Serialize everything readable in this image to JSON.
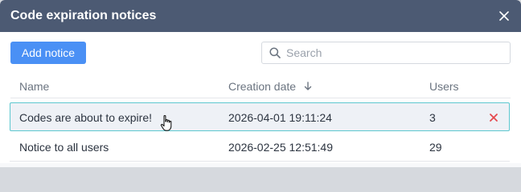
{
  "dialog": {
    "title": "Code expiration notices",
    "close_icon": "close-icon"
  },
  "toolbar": {
    "add_label": "Add notice",
    "search_placeholder": "Search",
    "search_value": "",
    "search_icon": "search-icon"
  },
  "table": {
    "columns": {
      "name": "Name",
      "creation_date": "Creation date",
      "users": "Users",
      "sort_icon": "arrow-down-icon"
    },
    "rows": [
      {
        "name": "Codes are about to expire!",
        "creation_date": "2026-04-01 19:11:24",
        "users": "3",
        "selected": true
      },
      {
        "name": "Notice to all users",
        "creation_date": "2026-02-25 12:51:49",
        "users": "29",
        "selected": false
      }
    ]
  },
  "colors": {
    "titlebar": "#4c5a73",
    "accent": "#4a90f5",
    "selected_border": "#5cc7cf",
    "delete": "#e5484d"
  }
}
